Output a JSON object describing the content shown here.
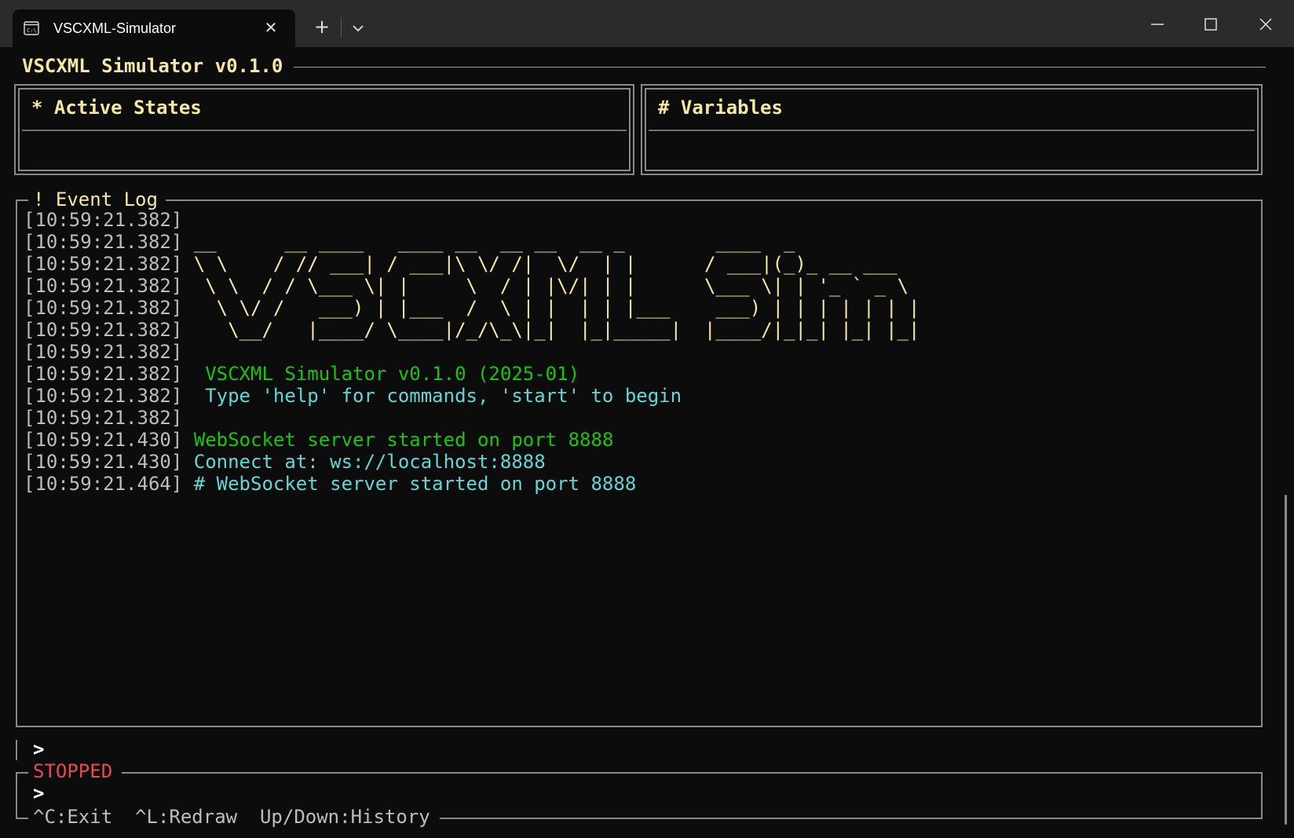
{
  "window": {
    "tab_title": "VSCXML-Simulator",
    "tab_icon": "terminal-icon",
    "close_tab_icon": "close-icon",
    "new_tab_icon": "plus-icon",
    "dropdown_icon": "chevron-down-icon",
    "controls": [
      "minimize-icon",
      "maximize-icon",
      "close-icon"
    ]
  },
  "app": {
    "title": "VSCXML Simulator v0.1.0"
  },
  "panels": {
    "active_states": {
      "title": "* Active States"
    },
    "variables": {
      "title": "# Variables"
    }
  },
  "event_log": {
    "title": "! Event Log",
    "lines": [
      {
        "ts": "[10:59:21.382]",
        "text": "",
        "color": "yellow"
      },
      {
        "ts": "[10:59:21.382]",
        "text": " __      __ ____   ____ __  __ __  __ _        ____  _",
        "color": "yellow"
      },
      {
        "ts": "[10:59:21.382]",
        "text": " \\ \\    / // ___| / ___|\\ \\/ /|  \\/  | |      / ___|(_)_ __ ___",
        "color": "yellow"
      },
      {
        "ts": "[10:59:21.382]",
        "text": "  \\ \\  / / \\___ \\| |     \\  / | |\\/| | |      \\___ \\| | '_ ` _ \\",
        "color": "yellow"
      },
      {
        "ts": "[10:59:21.382]",
        "text": "   \\ \\/ /   ___) | |___  /  \\ | |  | | |___    ___) | | | | | | |",
        "color": "yellow"
      },
      {
        "ts": "[10:59:21.382]",
        "text": "    \\__/   |____/ \\____|/_/\\_\\|_|  |_|_____|  |____/|_|_| |_| |_|",
        "color": "yellow"
      },
      {
        "ts": "[10:59:21.382]",
        "text": "",
        "color": "yellow"
      },
      {
        "ts": "[10:59:21.382]",
        "text": "  VSCXML Simulator v0.1.0 (2025-01)",
        "color": "green"
      },
      {
        "ts": "[10:59:21.382]",
        "text": "  Type 'help' for commands, 'start' to begin",
        "color": "cyan"
      },
      {
        "ts": "[10:59:21.382]",
        "text": "",
        "color": "cyan"
      },
      {
        "ts": "[10:59:21.430]",
        "text": " WebSocket server started on port 8888",
        "color": "green"
      },
      {
        "ts": "[10:59:21.430]",
        "text": " Connect at: ws://localhost:8888",
        "color": "cyan"
      },
      {
        "ts": "[10:59:21.464]",
        "text": " # WebSocket server started on port 8888",
        "color": "cyan"
      }
    ]
  },
  "input": {
    "prompt": ">"
  },
  "status": {
    "label": "STOPPED",
    "prompt": ">",
    "hints": "^C:Exit  ^L:Redraw  Up/Down:History"
  }
}
